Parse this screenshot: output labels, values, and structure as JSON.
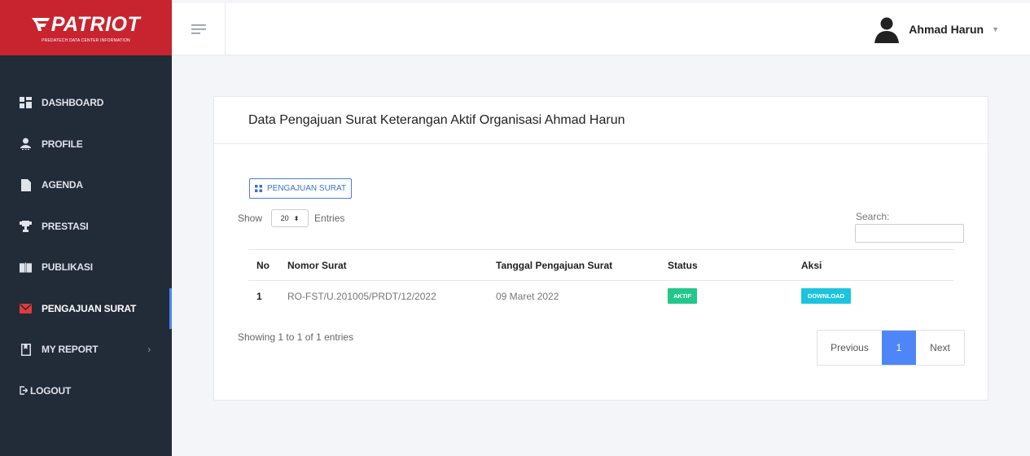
{
  "brand": {
    "name": "PATRIOT",
    "tagline": "PREDATECH DATA CENTER INFORMATION",
    "color": "#c8242f"
  },
  "sidebar": {
    "items": [
      {
        "label": "DASHBOARD",
        "icon": "dashboard-icon"
      },
      {
        "label": "PROFILE",
        "icon": "user-icon"
      },
      {
        "label": "AGENDA",
        "icon": "file-icon"
      },
      {
        "label": "PRESTASI",
        "icon": "trophy-icon"
      },
      {
        "label": "PUBLIKASI",
        "icon": "book-open-icon"
      },
      {
        "label": "PENGAJUAN SURAT",
        "icon": "mail-icon",
        "active": true
      },
      {
        "label": "MY REPORT",
        "icon": "bookmark-icon"
      }
    ],
    "logout": "LOGOUT",
    "my_report_chevron": "›"
  },
  "topbar": {
    "user_name": "Ahmad Harun",
    "user_caret": "▼"
  },
  "card": {
    "title": "Data Pengajuan Surat Keterangan Aktif Organisasi Ahmad Harun",
    "action_button": "PENGAJUAN SURAT",
    "show_label": "Show",
    "entries_value": "20",
    "entries_label": "Entries",
    "search_label": "Search:",
    "columns": [
      "No",
      "Nomor Surat",
      "Tanggal Pengajuan Surat",
      "Status",
      "Aksi"
    ],
    "rows": [
      {
        "no": "1",
        "nomor": "RO-FST/U.201005/PRDT/12/2022",
        "tanggal": "09 Maret 2022",
        "status": "AKTIF",
        "aksi": "DOWNLOAD"
      }
    ],
    "showing_text": "Showing 1 to 1 of 1 entries",
    "pagination": {
      "previous": "Previous",
      "current": "1",
      "next": "Next"
    }
  },
  "colors": {
    "sidebar_bg": "#222b38",
    "accent": "#4f86f7",
    "status_green": "#23c68b",
    "download_cyan": "#1ec3dd"
  }
}
